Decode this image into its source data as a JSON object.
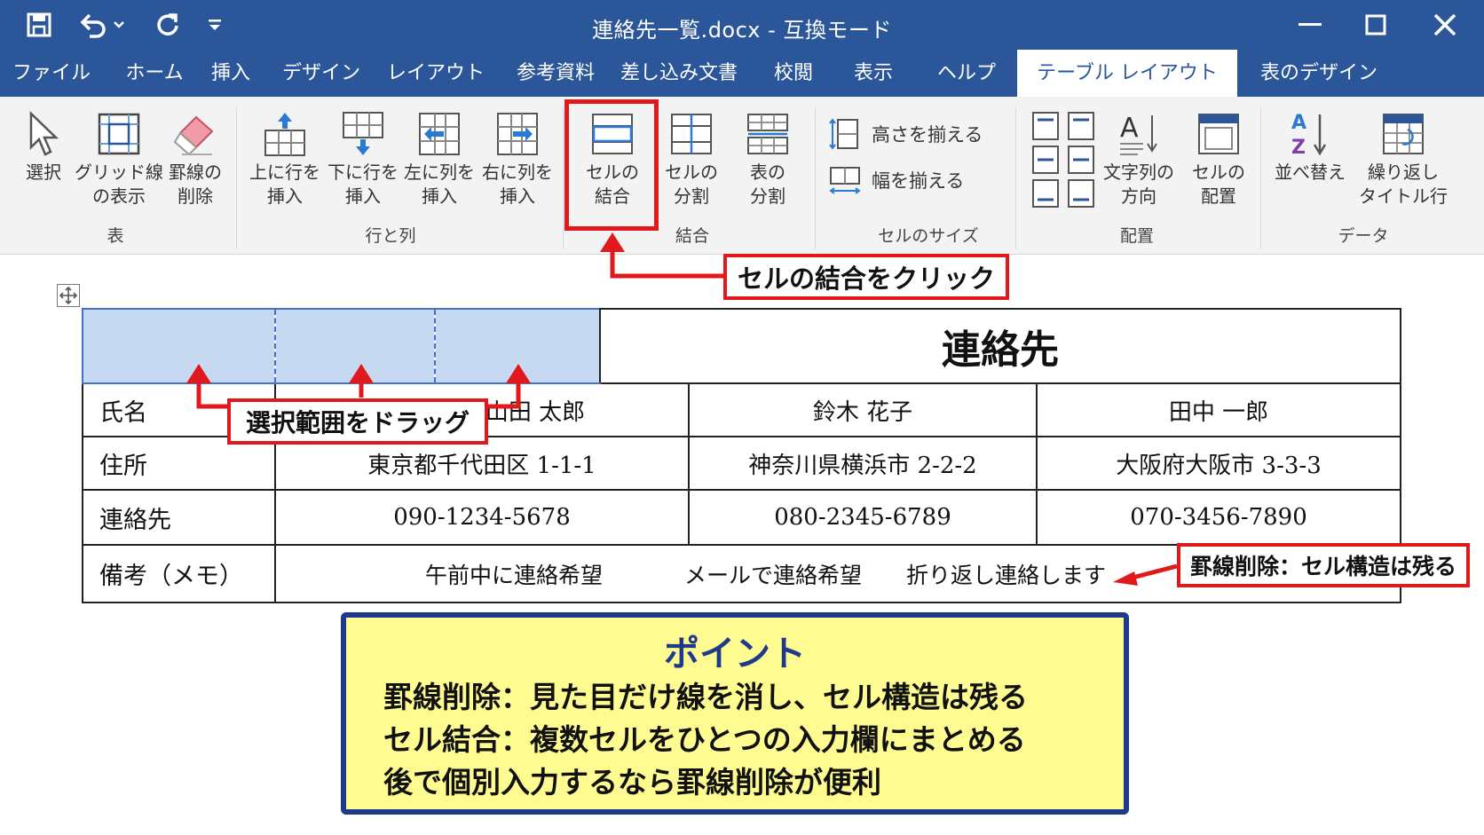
{
  "window": {
    "title": "連絡先一覧.docx  -  互換モード",
    "controls": {
      "minimize": "minimize",
      "maximize": "maximize",
      "close": "close"
    }
  },
  "quick_access": {
    "save": "save-icon",
    "undo": "undo-icon",
    "redo": "redo-icon",
    "customize": "customize-icon"
  },
  "tabs": [
    "ファイル",
    "ホーム",
    "挿入",
    "デザイン",
    "レイアウト",
    "参考資料",
    "差し込み文書",
    "校閲",
    "表示",
    "ヘルプ",
    "テーブル レイアウト",
    "表のデザイン"
  ],
  "active_tab": "テーブル レイアウト",
  "ribbon": {
    "groups": {
      "table": "表",
      "rows_cols": "行と列",
      "merge": "結合",
      "cell_size": "セルのサイズ",
      "alignment": "配置",
      "data": "データ"
    },
    "buttons": {
      "select": "選択",
      "gridlines_1": "グリッド線",
      "gridlines_2": "の表示",
      "eraser_1": "罫線の",
      "eraser_2": "削除",
      "insert_above_1": "上に行を",
      "insert_above_2": "挿入",
      "insert_below_1": "下に行を",
      "insert_below_2": "挿入",
      "insert_left_1": "左に列を",
      "insert_left_2": "挿入",
      "insert_right_1": "右に列を",
      "insert_right_2": "挿入",
      "merge_1": "セルの",
      "merge_2": "結合",
      "split_cells_1": "セルの",
      "split_cells_2": "分割",
      "split_table_1": "表の",
      "split_table_2": "分割",
      "distribute_rows": "高さを揃える",
      "distribute_cols": "幅を揃える",
      "text_direction_1": "文字列の",
      "text_direction_2": "方向",
      "cell_margins_1": "セルの",
      "cell_margins_2": "配置",
      "sort": "並べ替え",
      "repeat_header_1": "繰り返し",
      "repeat_header_2": "タイトル行"
    }
  },
  "table": {
    "title": "連絡先",
    "rows": [
      {
        "label": "氏名",
        "values": [
          "山田 太郎",
          "鈴木 花子",
          "田中 一郎"
        ]
      },
      {
        "label": "住所",
        "values": [
          "東京都千代田区 1-1-1",
          "神奈川県横浜市 2-2-2",
          "大阪府大阪市 3-3-3"
        ]
      },
      {
        "label": "連絡先",
        "values": [
          "090-1234-5678",
          "080-2345-6789",
          "070-3456-7890"
        ]
      },
      {
        "label": "備考（メモ）",
        "values": [
          "午前中に連絡希望",
          "メールで連絡希望",
          "折り返し連絡します"
        ]
      }
    ]
  },
  "callouts": {
    "merge_click": "セルの結合をクリック",
    "drag_selection": "選択範囲をドラッグ",
    "eraser_note": "罫線削除：セル構造は残る"
  },
  "point": {
    "title": "ポイント",
    "lines": [
      "罫線削除：見た目だけ線を消し、セル構造は残る",
      "セル結合：複数セルをひとつの入力欄にまとめる",
      "後で個別入力するなら罫線削除が便利"
    ]
  },
  "colors": {
    "accent": "#2b579a",
    "callout_red": "#e0191c",
    "selection": "#c6d9f1",
    "point_bg": "#fefb91",
    "point_border": "#1f3a8a"
  }
}
